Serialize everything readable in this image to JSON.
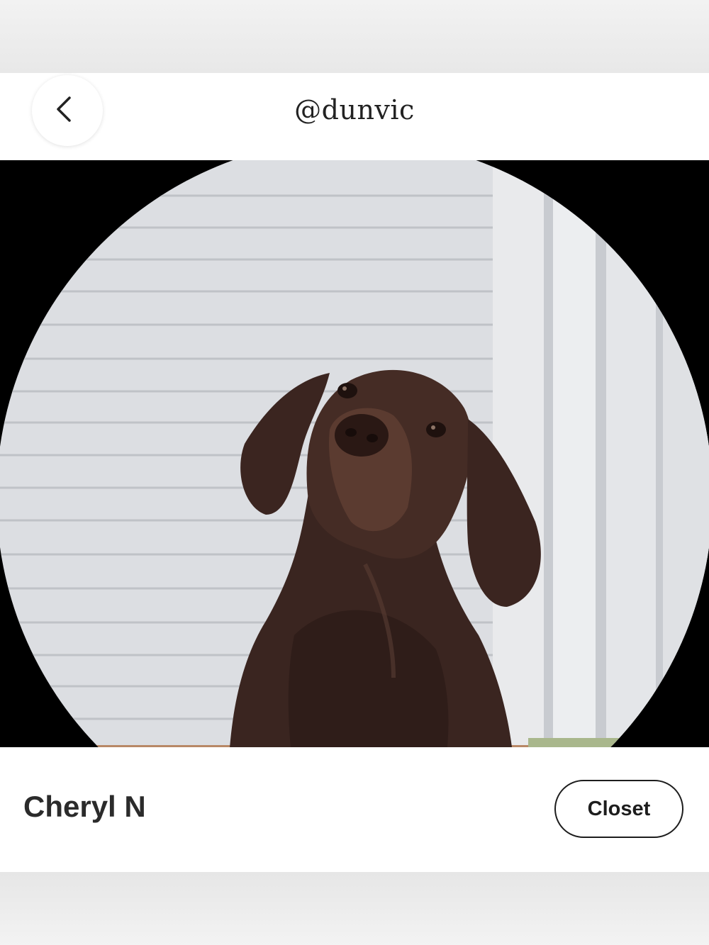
{
  "header": {
    "back_icon": "chevron-left-icon",
    "username": "@dunvic"
  },
  "profile": {
    "avatar_alt": "chocolate-dog-photo",
    "name": "Cheryl N",
    "closet_label": "Closet"
  },
  "colors": {
    "page_dim": "#e9e9e9",
    "sheet": "#ffffff",
    "photo_backdrop": "#000000",
    "text": "#2b2b2b"
  }
}
